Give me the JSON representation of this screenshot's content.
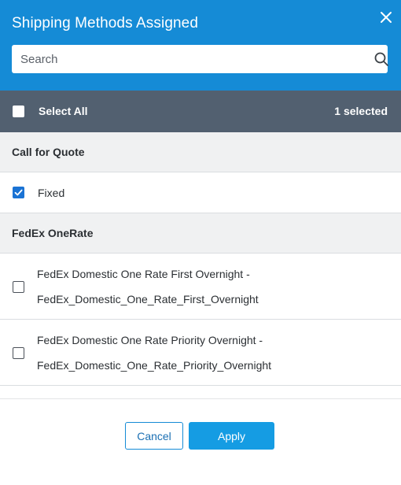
{
  "dialog": {
    "title": "Shipping Methods Assigned",
    "close_icon": "close-icon"
  },
  "search": {
    "placeholder": "Search",
    "value": "",
    "icon": "search-icon"
  },
  "select_all": {
    "label": "Select All",
    "checked": false,
    "selected_count": "1 selected"
  },
  "groups": [
    {
      "name": "Call for Quote",
      "items": [
        {
          "label": "Fixed",
          "checked": true
        }
      ]
    },
    {
      "name": "FedEx OneRate",
      "items": [
        {
          "line1": "FedEx Domestic One Rate First Overnight -",
          "line2": "FedEx_Domestic_One_Rate_First_Overnight",
          "checked": false
        },
        {
          "line1": "FedEx Domestic One Rate Priority Overnight -",
          "line2": "FedEx_Domestic_One_Rate_Priority_Overnight",
          "checked": false
        }
      ]
    }
  ],
  "footer": {
    "cancel_label": "Cancel",
    "apply_label": "Apply"
  },
  "colors": {
    "header_bg": "#158bd6",
    "select_all_bar_bg": "#526070",
    "checkbox_checked": "#1a73d4",
    "apply_bg": "#159ce3",
    "group_header_bg": "#f0f1f2"
  }
}
